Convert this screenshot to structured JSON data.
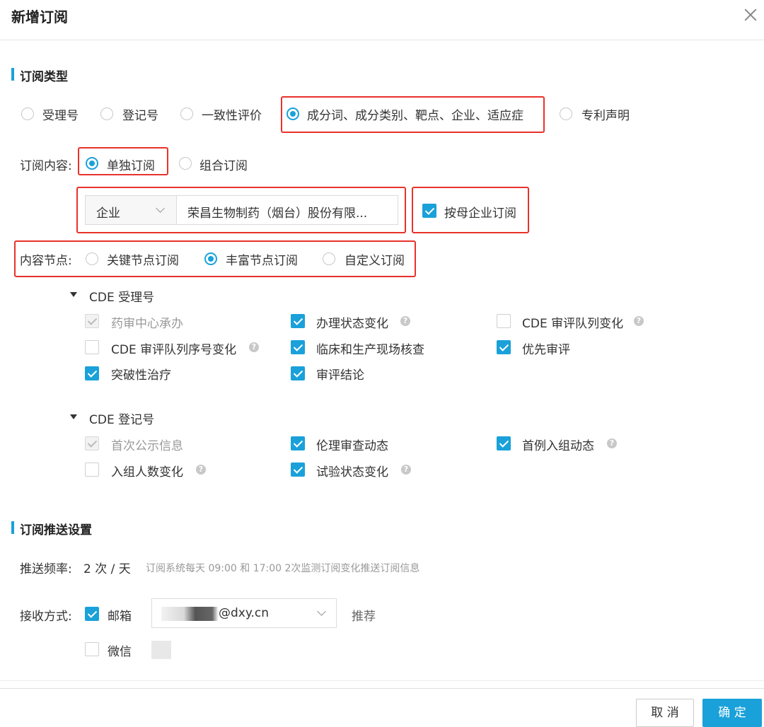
{
  "dialog": {
    "title": "新增订阅"
  },
  "type_section": {
    "title": "订阅类型",
    "options": [
      "受理号",
      "登记号",
      "一致性评价",
      "成分词、成分类别、靶点、企业、适应症",
      "专利声明"
    ],
    "selected_index": 3
  },
  "content": {
    "label": "订阅内容:",
    "options": [
      "单独订阅",
      "组合订阅"
    ],
    "selected_index": 0,
    "category_select": "企业",
    "company_value": "荣昌生物制药（烟台）股份有限...",
    "parent_company_label": "按母企业订阅",
    "parent_company_checked": true
  },
  "nodes": {
    "label": "内容节点:",
    "options": [
      "关键节点订阅",
      "丰富节点订阅",
      "自定义订阅"
    ],
    "selected_index": 1
  },
  "groups": [
    {
      "title": "CDE 受理号",
      "items": [
        {
          "label": "药审中心承办",
          "state": "disabled"
        },
        {
          "label": "办理状态变化",
          "state": "checked",
          "help": true
        },
        {
          "label": "CDE 审评队列变化",
          "state": "unchecked",
          "help": true
        },
        {
          "label": "CDE 审评队列序号变化",
          "state": "unchecked",
          "help": true
        },
        {
          "label": "临床和生产现场核查",
          "state": "checked"
        },
        {
          "label": "优先审评",
          "state": "checked"
        },
        {
          "label": "突破性治疗",
          "state": "checked"
        },
        {
          "label": "审评结论",
          "state": "checked"
        }
      ]
    },
    {
      "title": "CDE 登记号",
      "items": [
        {
          "label": "首次公示信息",
          "state": "disabled"
        },
        {
          "label": "伦理审查动态",
          "state": "checked"
        },
        {
          "label": "首例入组动态",
          "state": "checked",
          "help": true
        },
        {
          "label": "入组人数变化",
          "state": "unchecked",
          "help": true
        },
        {
          "label": "试验状态变化",
          "state": "checked",
          "help": true
        }
      ]
    }
  ],
  "push_section": {
    "title": "订阅推送设置",
    "freq_label": "推送频率:",
    "freq_value": "2 次 / 天",
    "freq_note": "订阅系统每天 09:00 和 17:00 2次监测订阅变化推送订阅信息",
    "recv_label": "接收方式:",
    "email_label": "邮箱",
    "email_checked": true,
    "email_value": "@dxy.cn",
    "recommend": "推荐",
    "wechat_label": "微信",
    "wechat_checked": false
  },
  "footer": {
    "cancel": "取 消",
    "ok": "确 定"
  },
  "colors": {
    "accent": "#1aa1d9",
    "highlight": "#e8322b"
  }
}
